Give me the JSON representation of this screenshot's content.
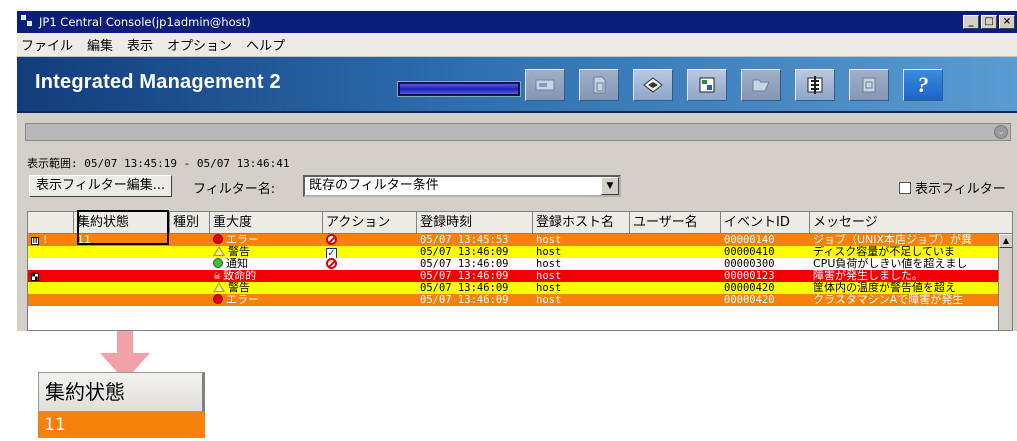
{
  "window": {
    "title": "JP1 Central Console(jp1admin@host)",
    "controls": [
      "_",
      "□",
      "×"
    ]
  },
  "menu": [
    "ファイル",
    "編集",
    "表示",
    "オプション",
    "ヘルプ"
  ],
  "banner": {
    "brand": "Integrated Management 2",
    "progress": 1.0,
    "toolbar_icons": [
      "monitor-icon",
      "document-icon",
      "event-icon",
      "tree-icon",
      "folder-icon",
      "function-icon",
      "report-icon",
      "help-icon"
    ],
    "help_label": "?"
  },
  "display_range": "表示範囲: 05/07 13:45:19 - 05/07 13:46:41",
  "filter": {
    "edit_button": "表示フィルター編集...",
    "name_label": "フィルター名:",
    "selected": "既存のフィルター条件",
    "toggle_label": "表示フィルター"
  },
  "columns": [
    "",
    "集約状態",
    "種別",
    "重大度",
    "アクション",
    "登録時刻",
    "登録ホスト名",
    "ユーザー名",
    "イベントID",
    "メッセージ"
  ],
  "rows": [
    {
      "color": "orange",
      "mark": "!",
      "agg": "11",
      "severity": "エラー",
      "sev_icon": "error",
      "action": "suppressed",
      "time": "05/07 13:45:53",
      "host": "host",
      "user": "",
      "event_id": "00000140",
      "message": "ジョブ（UNIX本店ジョブ）が異"
    },
    {
      "color": "yellow",
      "mark": "",
      "agg": "",
      "severity": "警告",
      "sev_icon": "warning",
      "action": "checked",
      "time": "05/07 13:46:09",
      "host": "host",
      "user": "",
      "event_id": "00000410",
      "message": "ディスク容量が不足していま"
    },
    {
      "color": "white",
      "mark": "",
      "agg": "",
      "severity": "通知",
      "sev_icon": "info",
      "action": "suppressed",
      "time": "05/07 13:46:09",
      "host": "host",
      "user": "",
      "event_id": "00000300",
      "message": "CPU負荷がしきい値を超えまし"
    },
    {
      "color": "red",
      "mark": "",
      "agg": "",
      "severity": "致命的",
      "sev_icon": "fatal",
      "action": "",
      "time": "05/07 13:46:09",
      "host": "host",
      "user": "",
      "event_id": "00000123",
      "message": "障害が発生しました。"
    },
    {
      "color": "yellow",
      "mark": "",
      "agg": "",
      "severity": "警告",
      "sev_icon": "warning",
      "action": "",
      "time": "05/07 13:46:09",
      "host": "host",
      "user": "",
      "event_id": "00000420",
      "message": "筐体内の温度が警告値を超え"
    },
    {
      "color": "orange",
      "mark": "",
      "agg": "",
      "severity": "エラー",
      "sev_icon": "error",
      "action": "",
      "time": "05/07 13:46:09",
      "host": "host",
      "user": "",
      "event_id": "00000420",
      "message": "クラスタマシンAで障害が発生"
    }
  ],
  "callout": {
    "header": "集約状態",
    "value": "11"
  },
  "colors": {
    "orange": "#f6820c",
    "yellow": "#ffff00",
    "red": "#f20000",
    "arrow": "#f4a0a8"
  }
}
